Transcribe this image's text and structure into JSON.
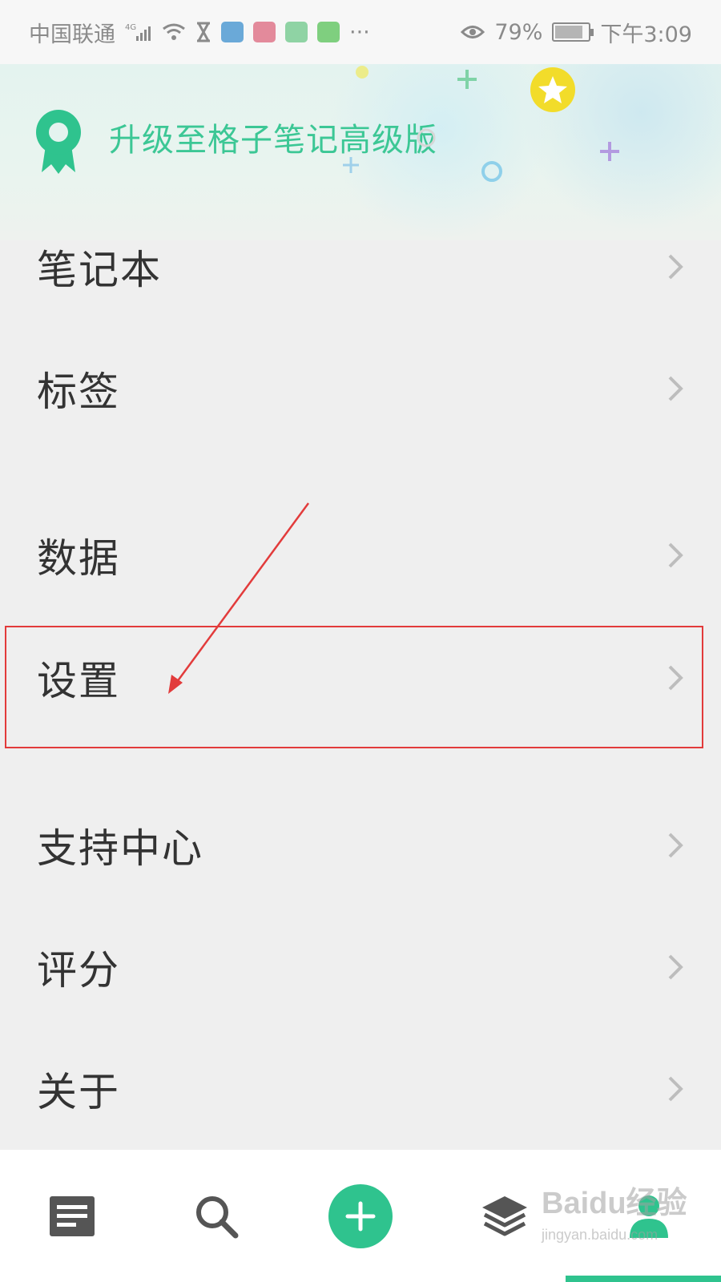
{
  "status_bar": {
    "carrier": "中国联通",
    "network": "4G",
    "battery": "79%",
    "time": "下午3:09",
    "overflow": "···"
  },
  "banner": {
    "title": "升级至格子笔记高级版"
  },
  "menu": {
    "items": [
      {
        "label": "笔记本"
      },
      {
        "label": "标签"
      },
      {
        "label": "数据"
      },
      {
        "label": "设置"
      },
      {
        "label": "支持中心"
      },
      {
        "label": "评分"
      },
      {
        "label": "关于"
      }
    ]
  },
  "bottom_nav": {
    "items": [
      "notes-icon",
      "search-icon",
      "add-icon",
      "layers-icon",
      "profile-icon"
    ],
    "accent_color": "#2fc38e"
  },
  "watermark": {
    "main": "Baidu经验",
    "sub": "jingyan.baidu.com"
  },
  "annotation": {
    "highlight_color": "#e23b3b"
  }
}
